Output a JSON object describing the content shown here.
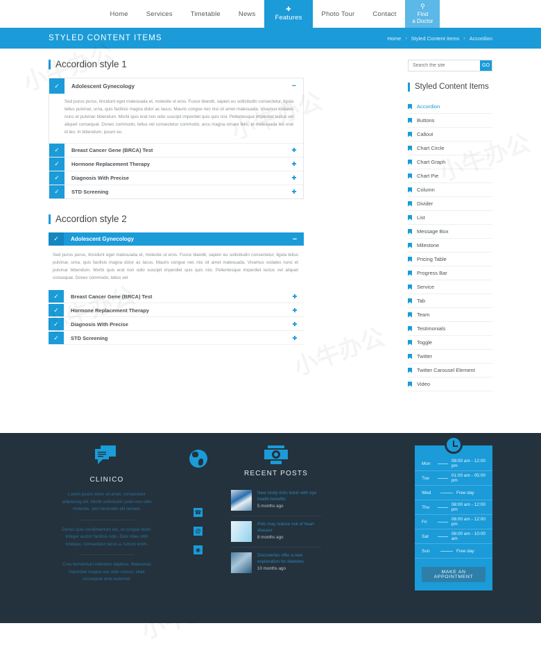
{
  "nav": {
    "items": [
      {
        "label": "Home",
        "active": false
      },
      {
        "label": "Services",
        "active": false
      },
      {
        "label": "Timetable",
        "active": false
      },
      {
        "label": "News",
        "active": false
      },
      {
        "label": "Features",
        "active": true
      },
      {
        "label": "Photo Tour",
        "active": false
      },
      {
        "label": "Contact",
        "active": false
      }
    ],
    "cta": {
      "line1": "Find",
      "line2": "a Doctor",
      "icon": "search-icon"
    }
  },
  "titlebar": {
    "title": "STYLED CONTENT ITEMS",
    "breadcrumbs": [
      "Home",
      "Styled Content Items",
      "Accordion"
    ],
    "separator": "›",
    "bg": "#1b9bd8"
  },
  "main": {
    "section1_title": "Accordion style 1",
    "section2_title": "Accordion style 2",
    "open_item_label": "Adolescent Gynecology",
    "body1": "Sed purus purus, tincidunt eget malesuada et, molestie ut eros. Fusce blandit, sapien eu sollicitudin consectetur, ligula tellus pulvinar, urna, quis facilisis magna dolor ac lacus. Mauris congue nec nisi sit amet malesuada. Vivamus sodales nunc et pulvinar bibendum. Morbi quis erat non odio suscipit imperdiet quis quis nisl. Pellentesque imperdiet lectus vel aliquet consequat. Donec commodo, tellus vel consectetur commodo, arcu magna ornare felis, et malesuada leo erat id leo. In bibendum, ipsum eu",
    "body2": "Sed purus purus, tincidunt eget malesuada et, molestie ut eros. Fusce blandit, sapien eu sollicitudin consectetur, ligula tellus pulvinar, urna, quis facilisis magna dolor ac lacus. Mauris congue nec nisi sit amet malesuada. Vivamus sodales nunc et pulvinar bibendum. Morbi quis erat non odio suscipit imperdiet quis quis nisl. Pellentesque imperdiet lectus vel aliquet consequat. Donec commodo, tellus vel",
    "collapsed_items": [
      "Breast Cancer Gene (BRCA) Test",
      "Hormone Replacement Therapy",
      "Diagnosis With Precise",
      "STD Screening"
    ],
    "minus_sign": "−",
    "plus_sign": "✚",
    "check_glyph": "✓"
  },
  "sidebar": {
    "search": {
      "placeholder": "Search the site",
      "value": "",
      "button": "GO"
    },
    "title": "Styled Content Items",
    "items": [
      {
        "label": "Accordion",
        "selected": true
      },
      {
        "label": "Buttons",
        "selected": false
      },
      {
        "label": "Callout",
        "selected": false
      },
      {
        "label": "Chart Circle",
        "selected": false
      },
      {
        "label": "Chart Graph",
        "selected": false
      },
      {
        "label": "Chart Pie",
        "selected": false
      },
      {
        "label": "Column",
        "selected": false
      },
      {
        "label": "Divider",
        "selected": false
      },
      {
        "label": "List",
        "selected": false
      },
      {
        "label": "Message Box",
        "selected": false
      },
      {
        "label": "Milestone",
        "selected": false
      },
      {
        "label": "Pricing Table",
        "selected": false
      },
      {
        "label": "Progress Bar",
        "selected": false
      },
      {
        "label": "Service",
        "selected": false
      },
      {
        "label": "Tab",
        "selected": false
      },
      {
        "label": "Team",
        "selected": false
      },
      {
        "label": "Testimonials",
        "selected": false
      },
      {
        "label": "Toggle",
        "selected": false
      },
      {
        "label": "Twitter",
        "selected": false
      },
      {
        "label": "Twitter Carousel Element",
        "selected": false
      },
      {
        "label": "Video",
        "selected": false
      }
    ]
  },
  "footer": {
    "bg": "#23323d",
    "brand": {
      "icon": "chat-bubble-icon",
      "name": "CLINICO",
      "p1": "Lorem ipsum dolor sit amet, consectetur adipiscing elit. Morbi sollicitudin justo non odio molestie, sed venenatis elit laoreet.",
      "p2": "Donec quis condimentum leo, et congue dolor. Integer auctor facilisis odio. Duis vitae nibh tristique, consectetur lacus a, rutrum enim.",
      "p3": "Cras fermentum interdum dapibus. Maecenas imperdiet magna nec odio cursus, vitae consequat ante euismod."
    },
    "social": {
      "globe_icon": "globe-icon",
      "icons": [
        "phone-icon",
        "email-icon",
        "location-icon"
      ],
      "glyphs": [
        "☎",
        "@",
        "◉"
      ]
    },
    "posts": {
      "heading": "RECENT POSTS",
      "icon": "camera-icon",
      "items": [
        {
          "title": "New study links lutein with eye health benefits",
          "date": "5 months ago",
          "thumb": "microscope-photo"
        },
        {
          "title": "Pets may reduce risk of heart disease",
          "date": "8 months ago",
          "thumb": "pills-photo"
        },
        {
          "title": "Discoveries offer a new explanation for diabetes",
          "date": "10 months ago",
          "thumb": "stethoscope-photo"
        }
      ]
    },
    "hours": {
      "icon": "clock-icon",
      "rows": [
        {
          "day": "Mon",
          "time": "08:00 am - 12:00 pm"
        },
        {
          "day": "Tue",
          "time": "01:00 am - 05:00 pm"
        },
        {
          "day": "Wed",
          "time": "Free day"
        },
        {
          "day": "Thu",
          "time": "08:00 am - 12:00 pm"
        },
        {
          "day": "Fri",
          "time": "08:00 am - 12:00 pm"
        },
        {
          "day": "Sat",
          "time": "08:00 am - 10:00 am"
        },
        {
          "day": "Sun",
          "time": "Free day"
        }
      ],
      "button": "MAKE AN APPOINTMENT"
    }
  },
  "watermark": "小牛办公"
}
